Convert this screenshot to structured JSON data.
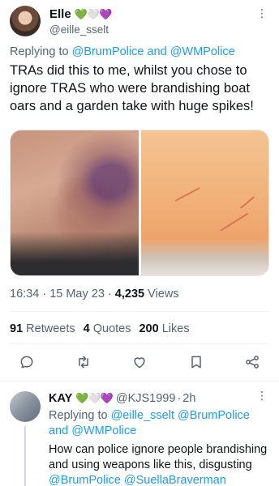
{
  "tweet": {
    "name": "Elle",
    "name_emoji": "💚🤍💜",
    "handle": "@eille_sselt",
    "more": "⋮",
    "replying_prefix": "Replying to",
    "mention_1": "@BrumPolice",
    "and_word": "and",
    "mention_2": "@WMPolice",
    "text": "TRAs did this to me, whilst you chose to ignore TRAS who were brandishing boat oars and a garden take with huge spikes!",
    "time": "16:34",
    "date": "15 May 23",
    "views_count": "4,235",
    "views_label": "Views",
    "stats": {
      "retweets_count": "91",
      "retweets_label": "Retweets",
      "quotes_count": "4",
      "quotes_label": "Quotes",
      "likes_count": "200",
      "likes_label": "Likes"
    },
    "actions": [
      "reply-icon",
      "retweet-icon",
      "like-icon",
      "bookmark-icon",
      "share-icon"
    ]
  },
  "reply": {
    "name": "KAY",
    "name_emoji": "💚🤍💜",
    "handle": "@KJS1999",
    "time": "2h",
    "more": "⋮",
    "replying_prefix": "Replying to",
    "mention_1": "@eille_sselt",
    "mention_2": "@BrumPolice",
    "and_word": "and",
    "mention_3": "@WMPolice",
    "text_line_1": "How can police ignore people brandishing and using weapons like this, disgusting",
    "mention_4": "@BrumPolice",
    "mention_5": "@SuellaBraverman"
  },
  "colors": {
    "link": "#1d9bf0",
    "secondary": "#536471",
    "primary_text": "#0f1419"
  }
}
